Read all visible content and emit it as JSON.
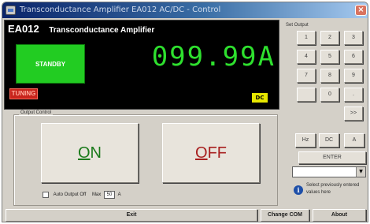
{
  "window": {
    "title": "Trans​cond​ucta​nce Ampl​ifier EA012 AC/DC - Control",
    "close_glyph": "×"
  },
  "display": {
    "model": "EA012",
    "description": "Transconductance Amplifier",
    "status": "STANDBY",
    "reading": "099.99A",
    "tuning_label": "TUNING",
    "mode_badge": "DC"
  },
  "output_control": {
    "group_label": "Output Control",
    "on_mnemonic": "O",
    "on_rest": "N",
    "off_mnemonic": "O",
    "off_rest": "FF",
    "auto_off_label": "Auto Output Off",
    "max_label": "Max",
    "max_value": "50",
    "max_unit": "A"
  },
  "keypad": {
    "label": "Set Output",
    "keys": [
      "1",
      "2",
      "3",
      "4",
      "5",
      "6",
      "7",
      "8",
      "9",
      "",
      "0",
      "."
    ],
    "extra_key": ">>",
    "modes": [
      "Hz",
      "DC",
      "A"
    ],
    "enter_label": "ENTER",
    "select_arrow": "▼",
    "hint_text": "Select previously entered values here"
  },
  "bottom": {
    "exit_label": "Exit",
    "change_com_label": "Change COM",
    "about_label": "About"
  },
  "colors": {
    "standby": "#22cc22",
    "reading": "#2ee02e",
    "on_text": "#1a7a1a",
    "off_text": "#a82020",
    "tuning": "#c8241c",
    "dc_badge": "#e8e800"
  }
}
